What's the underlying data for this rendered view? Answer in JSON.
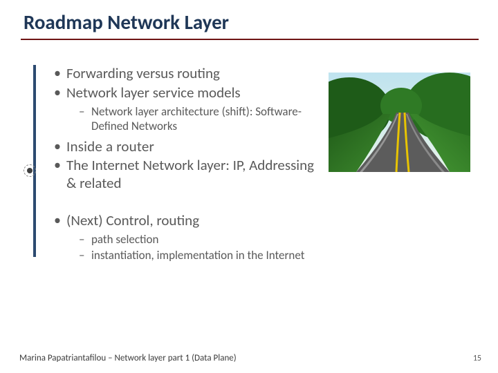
{
  "title": "Roadmap Network Layer",
  "bullets": {
    "b1": "Forwarding versus routing",
    "b2": "Network layer service models",
    "b2_sub1": "Network layer architecture (shift): Software-Defined Networks",
    "b3": "Inside a router",
    "b4": "The Internet Network layer: IP, Addressing & related",
    "b5": "(Next) Control, routing",
    "b5_sub1": "path selection",
    "b5_sub2": "instantiation, implementation in the Internet"
  },
  "footer": "Marina Papatriantafilou – Network layer part 1 (Data Plane)",
  "page_number": "15",
  "colors": {
    "heading": "#1f3757",
    "rule": "#6e1414",
    "body": "#595959"
  },
  "image": {
    "name": "road-photo",
    "alt": "Curving forest road with double yellow lines"
  }
}
